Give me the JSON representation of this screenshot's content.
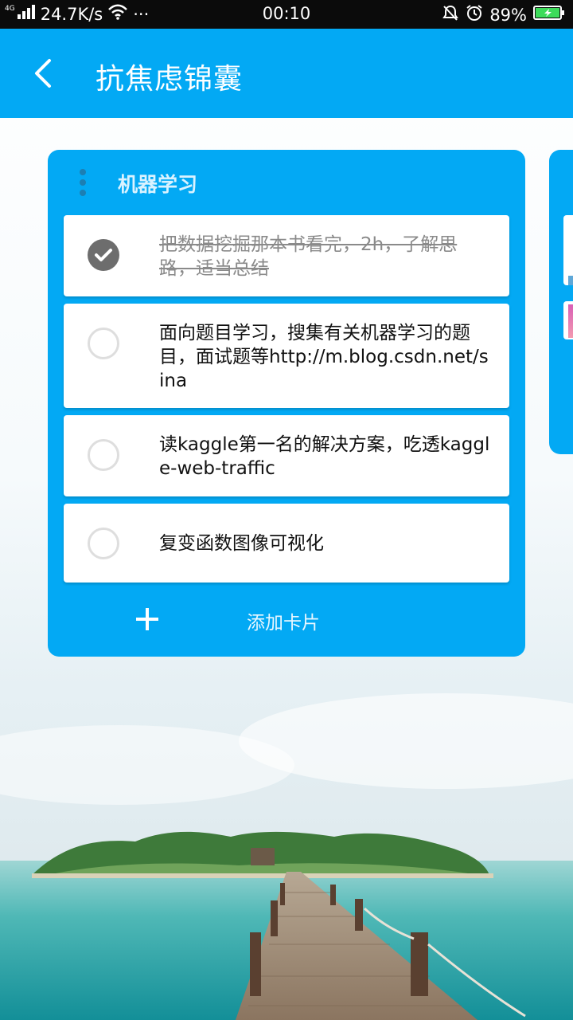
{
  "status_bar": {
    "network_type": "4G",
    "speed": "24.7K/s",
    "more": "···",
    "time": "00:10",
    "battery": "89%",
    "icons": [
      "signal-icon",
      "wifi-icon",
      "mute-icon",
      "alarm-icon",
      "battery-charging-icon"
    ]
  },
  "app_bar": {
    "title": "抗焦虑锦囊",
    "back_icon": "back-arrow-icon"
  },
  "board": {
    "list": {
      "title": "机器学习",
      "cards": [
        {
          "text": "把数据挖掘那本书看完，2h，了解思路，适当总结",
          "done": true
        },
        {
          "text": "面向题目学习，搜集有关机器学习的题目，面试题等http://m.blog.csdn.net/sina",
          "done": false
        },
        {
          "text": "读kaggle第一名的解决方案，吃透kaggle-web-traffic",
          "done": false
        },
        {
          "text": "复变函数图像可视化",
          "done": false
        }
      ],
      "add_card_label": "添加卡片"
    }
  },
  "colors": {
    "accent": "#03a9f4",
    "status_bar": "#0b0b0b",
    "done_check": "#6d6d6d",
    "battery_fill": "#3ddc5a"
  }
}
